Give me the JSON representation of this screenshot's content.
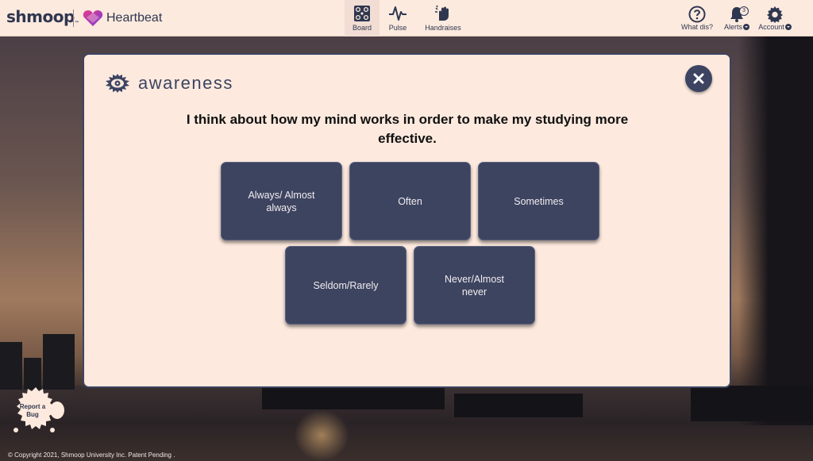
{
  "header": {
    "brand_shmoop": "shmoop",
    "brand_tm": "™",
    "brand_heartbeat": "Heartbeat",
    "nav": [
      {
        "label": "Board",
        "icon": "board-icon",
        "active": true
      },
      {
        "label": "Pulse",
        "icon": "pulse-icon",
        "active": false
      },
      {
        "label": "Handraises",
        "icon": "handraise-icon",
        "active": false
      }
    ],
    "right": {
      "what_dis": "What dis?",
      "alerts": "Alerts",
      "alerts_count": "3",
      "account": "Account"
    }
  },
  "modal": {
    "title": "awareness",
    "question": "I think about how my mind works in order to make my studying more effective.",
    "options": [
      "Always/ Almost always",
      "Often",
      "Sometimes",
      "Seldom/Rarely",
      "Never/Almost never"
    ]
  },
  "report_bug": "Report a Bug",
  "footer": {
    "copyright": "© Copyright 2021, Shmoop University Inc. Patent Pending ."
  },
  "colors": {
    "accent_navy": "#3c4460",
    "panel_bg": "#fde9dd",
    "header_bg": "#fdeadf"
  }
}
